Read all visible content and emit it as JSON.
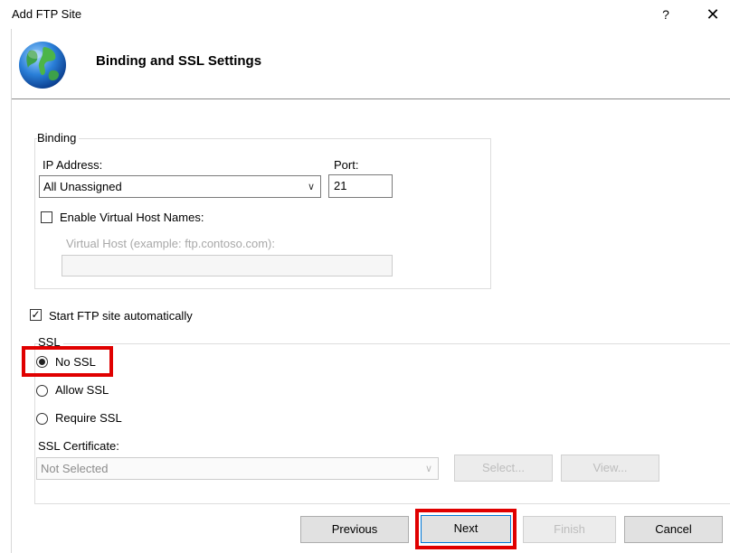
{
  "window": {
    "title": "Add FTP Site",
    "help_label": "?",
    "close_label": "✕"
  },
  "header": {
    "title": "Binding and SSL Settings",
    "icon": "globe-icon"
  },
  "binding": {
    "group_label": "Binding",
    "ip_label": "IP Address:",
    "ip_value": "All Unassigned",
    "port_label": "Port:",
    "port_value": "21",
    "virtual_host_checkbox_label": "Enable Virtual Host Names:",
    "virtual_host_checked": false,
    "virtual_host_label": "Virtual Host (example: ftp.contoso.com):",
    "virtual_host_value": ""
  },
  "start_automatically": {
    "label": "Start FTP site automatically",
    "checked": true
  },
  "ssl": {
    "group_label": "SSL",
    "options": [
      "No SSL",
      "Allow SSL",
      "Require SSL"
    ],
    "selected": "No SSL",
    "certificate_label": "SSL Certificate:",
    "certificate_value": "Not Selected",
    "select_button": "Select...",
    "view_button": "View..."
  },
  "buttons": {
    "previous": "Previous",
    "next": "Next",
    "finish": "Finish",
    "cancel": "Cancel"
  },
  "colors": {
    "highlight": "#e00000",
    "default_button_border": "#0078d7"
  }
}
